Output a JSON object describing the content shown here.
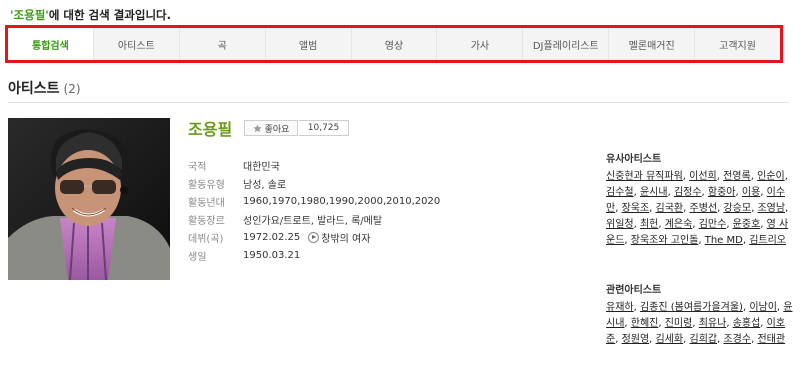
{
  "search": {
    "query": "조용필",
    "open_quote": "'",
    "close_quote": "'",
    "suffix": "에 대한 검색 결과입니다."
  },
  "tabs": [
    {
      "label": "통합검색",
      "active": true
    },
    {
      "label": "아티스트",
      "active": false
    },
    {
      "label": "곡",
      "active": false
    },
    {
      "label": "앨범",
      "active": false
    },
    {
      "label": "영상",
      "active": false
    },
    {
      "label": "가사",
      "active": false
    },
    {
      "label": "DJ플레이리스트",
      "active": false
    },
    {
      "label": "멜론매거진",
      "active": false
    },
    {
      "label": "고객지원",
      "active": false
    }
  ],
  "section": {
    "title": "아티스트",
    "count": "(2)"
  },
  "artist": {
    "name": "조용필",
    "like_label": "좋아요",
    "like_count": "10,725",
    "details": [
      {
        "label": "국적",
        "value": "대한민국"
      },
      {
        "label": "활동유형",
        "value": "남성, 솔로"
      },
      {
        "label": "활동년대",
        "value": "1960,1970,1980,1990,2000,2010,2020"
      },
      {
        "label": "활동장르",
        "value": "성인가요/트로트, 발라드, 록/메탈"
      },
      {
        "label": "데뷔(곡)",
        "value": "1972.02.25",
        "extra": "창밖의 여자"
      },
      {
        "label": "생일",
        "value": "1950.03.21"
      }
    ]
  },
  "similar": {
    "title": "유사아티스트",
    "names": [
      "신중현과 뮤직파워",
      "이선희",
      "전영록",
      "인순이",
      "김수철",
      "윤시내",
      "김정수",
      "함중아",
      "이용",
      "이수만",
      "장욱조",
      "김국환",
      "주병선",
      "강승모",
      "조영남",
      "위일청",
      "최헌",
      "계은숙",
      "김만수",
      "윤중호",
      "영 사운드",
      "장욱조와 고인돌",
      "The MD",
      "김트리오"
    ]
  },
  "related": {
    "title": "관련아티스트",
    "names": [
      "유재하",
      "김종진 (봄여름가을겨울)",
      "이남이",
      "윤시내",
      "한혜진",
      "진미령",
      "최유나",
      "송홍섭",
      "이호준",
      "정원영",
      "김세화",
      "김희갑",
      "조경수",
      "전태관"
    ]
  },
  "icons": {
    "like": "star-icon",
    "debut": "play-icon"
  },
  "colors": {
    "accent_green": "#3c9e17",
    "highlight_border": "#e3141b"
  }
}
